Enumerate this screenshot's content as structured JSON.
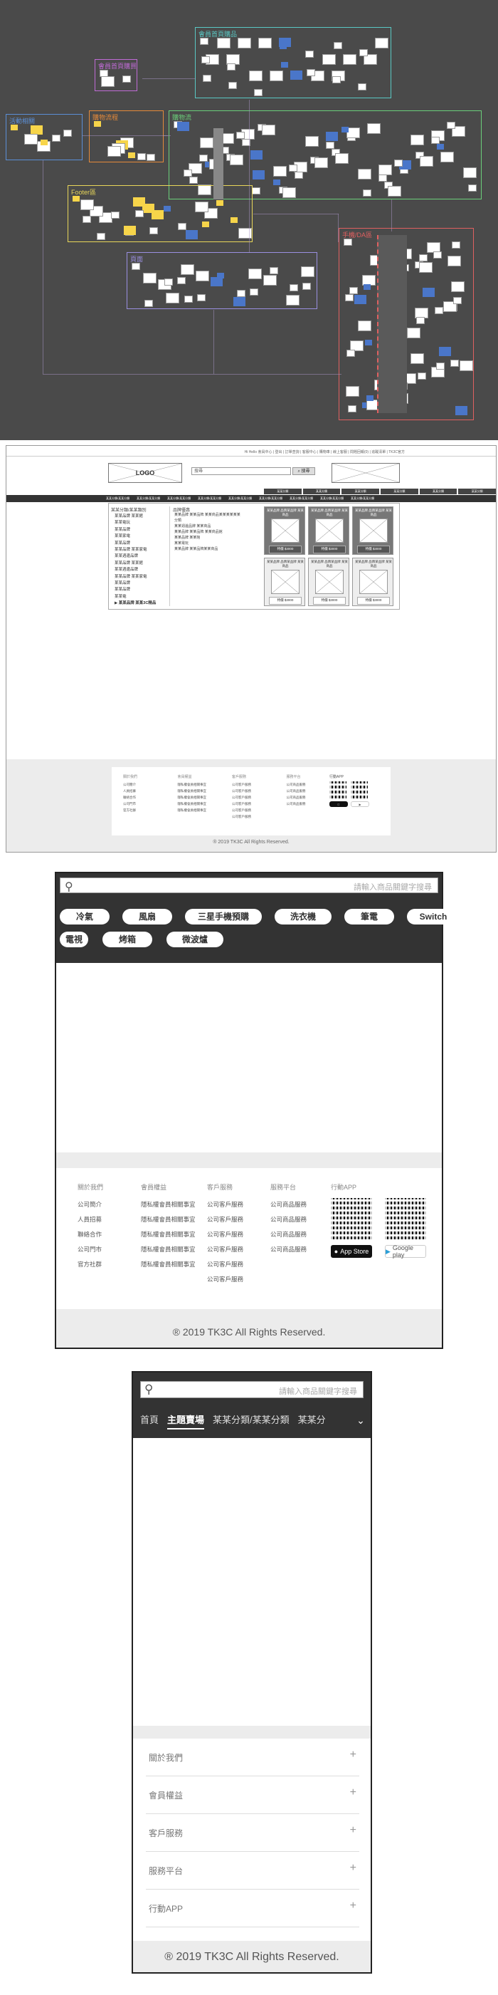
{
  "overview": {
    "groups": [
      {
        "label": "會員首頁購買",
        "color": "#c06bd6"
      },
      {
        "label": "會員首頁購品",
        "color": "#5ac8c4"
      },
      {
        "label": "活動相關",
        "color": "#5b8fd6"
      },
      {
        "label": "購物流程",
        "color": "#e58a3a"
      },
      {
        "label": "購物流",
        "color": "#6bcf7a"
      },
      {
        "label": "Footer區",
        "color": "#e8d65a"
      },
      {
        "label": "頁面",
        "color": "#9a8fe0"
      },
      {
        "label": "手機/DA區",
        "color": "#e06060"
      }
    ]
  },
  "desktop": {
    "top_links": "Hi  Hello  會員中心  |  登出  |  訂單查詢  |  客服中心  |  購物車  |  線上客服  |  問題回報(0)  |  追蹤清單  |  TK3C官方",
    "logo": "LOGO",
    "search_placeholder": "搜尋",
    "search_button": "搜尋",
    "nav": [
      "某某分類/某某分類",
      "某某分類/某某分類",
      "某某分類/某某分類",
      "某某分類/某某分類",
      "某某分類/某某分類",
      "某某分類/某某分類",
      "某某分類/某某分類",
      "某某分類/某某分類",
      "某某分類/某某分類"
    ],
    "promo_tabs": [
      "某某分類",
      "某某分類",
      "某某分類",
      "某某分類",
      "某某分類",
      "某某分類"
    ],
    "cat_header": "某某分類/某某類別",
    "categories": [
      "某某品牌 某某館",
      "某某電玩",
      "某某品牌",
      "某某家電",
      "某某品牌",
      "某某品牌 某某家電",
      "某某週邊品牌",
      "某某品牌 某某館",
      "某某週邊品牌",
      "某某品牌 某某家電",
      "某某品牌",
      "某某品牌",
      "某某電",
      "▶ 某某品牌 某某3C精品"
    ],
    "sub_header": "品牌優惠",
    "sub_items": [
      "某某品牌 某某品牌 某某商品某某某某某某",
      "分類",
      "某某週邊品牌 某某商品",
      "某某品牌 某某品牌 某某商品館",
      "某某品牌 某某館",
      "某某電玩",
      "某某品牌 某某品牌某某商品"
    ],
    "products": [
      {
        "name": "某某品牌 品牌某品牌 某某商品",
        "price": "特價 $3000"
      },
      {
        "name": "某某品牌 品牌某品牌 某某商品",
        "price": "特價 $3000"
      },
      {
        "name": "某某品牌 品牌某品牌 某某商品",
        "price": "特價 $3000"
      },
      {
        "name": "某某品牌 品牌某品牌 某某商品",
        "price": "特價 $3000"
      },
      {
        "name": "某某品牌 品牌某品牌 某某商品",
        "price": "特價 $3000"
      },
      {
        "name": "某某品牌 品牌某品牌 某某商品",
        "price": "特價 $3000"
      }
    ],
    "footer_cols": [
      {
        "title": "關於我們",
        "items": [
          "公司簡介",
          "人員招募",
          "聯絡合作",
          "公司門市",
          "官方社群"
        ]
      },
      {
        "title": "會員權益",
        "items": [
          "隱私權會員相關事宜",
          "隱私權會員相關事宜",
          "隱私權會員相關事宜",
          "隱私權會員相關事宜",
          "隱私權會員相關事宜"
        ]
      },
      {
        "title": "客戶服務",
        "items": [
          "公司客戶服務",
          "公司客戶服務",
          "公司客戶服務",
          "公司客戶服務",
          "公司客戶服務",
          "公司客戶服務"
        ]
      },
      {
        "title": "服務平台",
        "items": [
          "公司商品服務",
          "公司商品服務",
          "公司商品服務",
          "公司商品服務"
        ]
      }
    ],
    "app_title": "行動APP",
    "copyright": "® 2019 TK3C All Rights Reserved."
  },
  "tablet": {
    "search_placeholder": "請輸入商品關鍵字搜尋",
    "chips": [
      "冷氣",
      "風扇",
      "三星手機預購",
      "洗衣機",
      "筆電",
      "Switch",
      "電視",
      "烤箱",
      "微波爐"
    ],
    "footer_cols": [
      {
        "title": "關於我們",
        "items": [
          "公司簡介",
          "人員招募",
          "聯絡合作",
          "公司門市",
          "官方社群"
        ]
      },
      {
        "title": "會員權益",
        "items": [
          "隱私權會員相關事宜",
          "隱私權會員相關事宜",
          "隱私權會員相關事宜",
          "隱私權會員相關事宜",
          "隱私權會員相關事宜"
        ]
      },
      {
        "title": "客戶服務",
        "items": [
          "公司客戶服務",
          "公司客戶服務",
          "公司客戶服務",
          "公司客戶服務",
          "公司客戶服務",
          "公司客戶服務"
        ]
      },
      {
        "title": "服務平台",
        "items": [
          "公司商品服務",
          "公司商品服務",
          "公司商品服務",
          "公司商品服務"
        ]
      }
    ],
    "app_title": "行動APP",
    "app_store": "App Store",
    "google_play": "Google play",
    "copyright": "® 2019 TK3C All Rights Reserved."
  },
  "mobile": {
    "search_placeholder": "請輸入商品關鍵字搜尋",
    "tabs": [
      "首頁",
      "主題賣場",
      "某某分類/某某分類",
      "某某分"
    ],
    "active_tab": 1,
    "accordion": [
      "關於我們",
      "會員權益",
      "客戶服務",
      "服務平台",
      "行動APP"
    ],
    "copyright": "® 2019 TK3C All Rights Reserved."
  }
}
